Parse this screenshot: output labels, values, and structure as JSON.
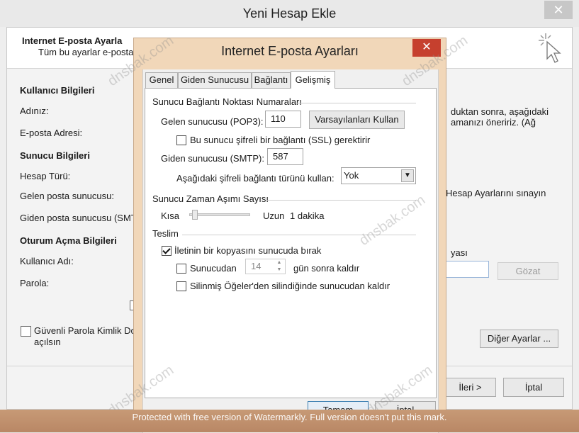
{
  "back_window": {
    "title": "Yeni Hesap Ekle",
    "close_glyph": "✕",
    "header_title": "Internet E-posta Ayarla",
    "header_subtitle": "Tüm bu ayarlar e-posta",
    "sections": {
      "user_info": "Kullanıcı Bilgileri",
      "server_info": "Sunucu Bilgileri",
      "login_info": "Oturum Açma Bilgileri"
    },
    "labels": {
      "name": "Adınız:",
      "email": "E-posta Adresi:",
      "account_type": "Hesap Türü:",
      "incoming": "Gelen posta sunucusu:",
      "outgoing": "Giden posta sunucusu (SMT",
      "username": "Kullanıcı Adı:",
      "password": "Parola:",
      "spa_line1": "Güvenli Parola Kimlik Doğ",
      "spa_line2": "açılsın"
    },
    "right_text": {
      "line1": "duktan sonra, aşağıdaki",
      "line2": "amanızı öneririz. (Ağ",
      "test_line": "Hesap Ayarlarını sınayın",
      "browse_label": "yası"
    },
    "buttons": {
      "browse": "Gözat",
      "more_settings": "Diğer Ayarlar ...",
      "next": "İleri >",
      "cancel": "İptal"
    }
  },
  "dialog": {
    "title": "Internet E-posta Ayarları",
    "close_glyph": "✕",
    "tabs": [
      {
        "label": "Genel",
        "active": false
      },
      {
        "label": "Giden Sunucusu",
        "active": false
      },
      {
        "label": "Bağlantı",
        "active": false
      },
      {
        "label": "Gelişmiş",
        "active": true
      }
    ],
    "groups": {
      "ports": "Sunucu Bağlantı Noktası Numaraları",
      "timeout": "Sunucu Zaman Aşımı Sayısı",
      "delivery": "Teslim"
    },
    "incoming_label": "Gelen sunucusu (POP3):",
    "incoming_value": "110",
    "defaults_button": "Varsayılanları Kullan",
    "ssl_label": "Bu sunucu şifreli bir bağlantı (SSL) gerektirir",
    "ssl_checked": false,
    "outgoing_label": "Giden sunucusu (SMTP):",
    "outgoing_value": "587",
    "encryption_label": "Aşağıdaki şifreli bağlantı türünü kullan:",
    "encryption_value": "Yok",
    "timeout_short": "Kısa",
    "timeout_long": "Uzun",
    "timeout_value": "1 dakika",
    "timeout_level": 0.05,
    "leave_copy_label": "İletinin bir kopyasını sunucuda bırak",
    "leave_copy_checked": true,
    "remove_after_prefix": "Sunucudan",
    "remove_after_days": "14",
    "remove_after_suffix": "gün sonra kaldır",
    "remove_after_checked": false,
    "remove_deleted_label": "Silinmiş Öğeler'den silindiğinde sunucudan kaldır",
    "remove_deleted_checked": false,
    "ok_button": "Tamam",
    "cancel_button": "İptal"
  },
  "watermark": {
    "banner": "Protected with free version of Watermarkly. Full version doesn't put this mark.",
    "tile": "dnsbak.com"
  }
}
